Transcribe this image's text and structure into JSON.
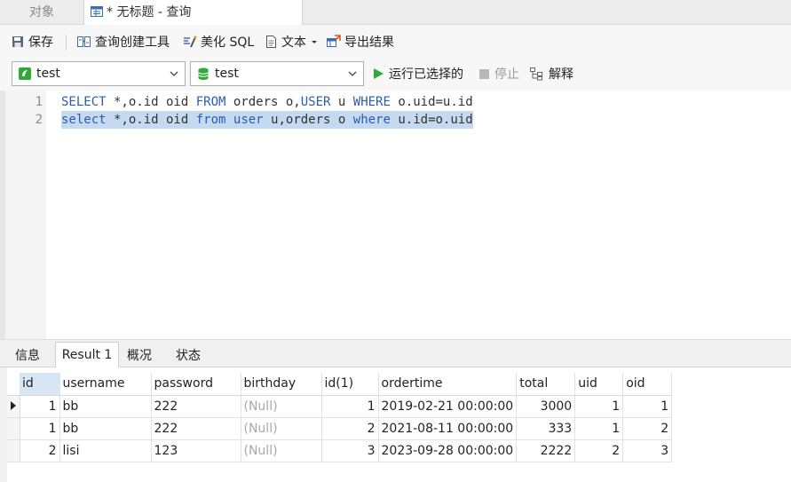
{
  "tabs": {
    "objects": "对象",
    "query": "* 无标题 - 查询"
  },
  "toolbar": {
    "save": "保存",
    "query_builder": "查询创建工具",
    "beautify": "美化 SQL",
    "text": "文本",
    "export": "导出结果"
  },
  "dbrow": {
    "connection": "test",
    "database": "test",
    "run_selected": "运行已选择的",
    "stop": "停止",
    "explain": "解释"
  },
  "editor": {
    "lines": [
      {
        "num": "1",
        "tokens": [
          {
            "t": "SELECT",
            "kw": true
          },
          {
            "t": " *,o.id oid ",
            "kw": false
          },
          {
            "t": "FROM",
            "kw": true
          },
          {
            "t": " orders o,",
            "kw": false
          },
          {
            "t": "USER",
            "kw": true
          },
          {
            "t": " u ",
            "kw": false
          },
          {
            "t": "WHERE",
            "kw": true
          },
          {
            "t": " o.uid=u.id",
            "kw": false
          }
        ]
      },
      {
        "num": "2",
        "selected": true,
        "tokens": [
          {
            "t": "select",
            "kw": true
          },
          {
            "t": " *,o.id oid ",
            "kw": false
          },
          {
            "t": "from",
            "kw": true
          },
          {
            "t": " ",
            "kw": false
          },
          {
            "t": "user",
            "kw": true
          },
          {
            "t": " u,orders o ",
            "kw": false
          },
          {
            "t": "where",
            "kw": true
          },
          {
            "t": " u.id=o.uid",
            "kw": false
          }
        ]
      }
    ]
  },
  "results": {
    "tabs": [
      "信息",
      "Result 1",
      "概况",
      "状态"
    ],
    "active_tab": 1,
    "columns": [
      "id",
      "username",
      "password",
      "birthday",
      "id(1)",
      "ordertime",
      "total",
      "uid",
      "oid"
    ],
    "sorted_column": 0,
    "rows": [
      [
        "1",
        "bb",
        "222",
        "(Null)",
        "1",
        "2019-02-21 00:00:00",
        "3000",
        "1",
        "1"
      ],
      [
        "1",
        "bb",
        "222",
        "(Null)",
        "2",
        "2021-08-11 00:00:00",
        "333",
        "1",
        "2"
      ],
      [
        "2",
        "lisi",
        "123",
        "(Null)",
        "3",
        "2023-09-28 00:00:00",
        "2222",
        "2",
        "3"
      ]
    ],
    "current_row": 0
  },
  "colors": {
    "keyword": "#2a5db0",
    "selection": "#c5d9f1",
    "run_green": "#2faa3a",
    "null_text": "#a8a8a8"
  },
  "icons": [
    "query-tab-icon",
    "save-icon",
    "query-builder-icon",
    "beautify-sql-icon",
    "text-icon",
    "export-icon",
    "connection-icon",
    "database-icon",
    "run-icon",
    "stop-icon",
    "explain-icon"
  ]
}
